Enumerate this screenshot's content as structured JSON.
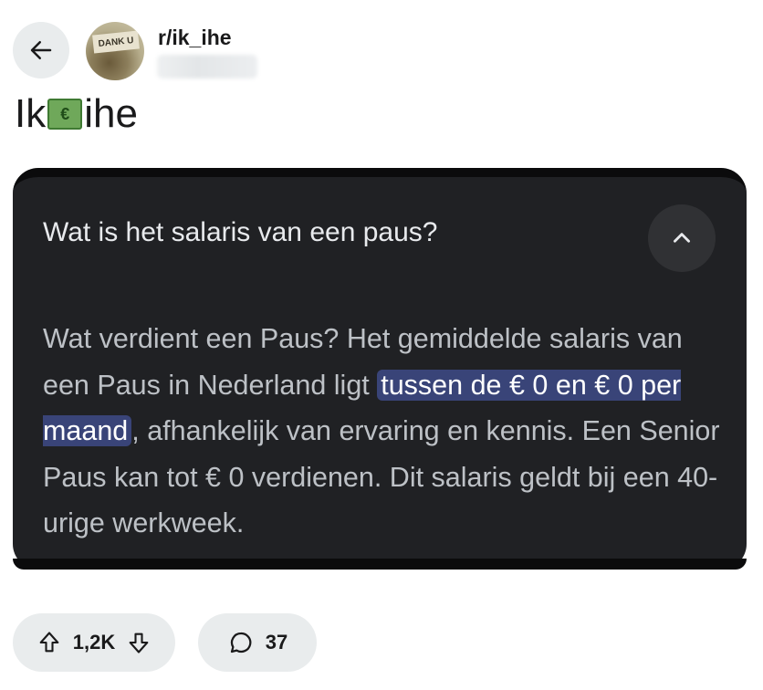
{
  "header": {
    "subreddit": "r/ik_ihe"
  },
  "post": {
    "title_prefix": "Ik",
    "title_suffix": "ihe",
    "title_icon_glyph": "€",
    "avatar_sign_text": "DANK U"
  },
  "card": {
    "question": "Wat is het salaris van een paus?",
    "answer_part1": "Wat verdient een Paus? Het gemiddelde salaris van een Paus in Nederland ligt ",
    "answer_highlight": "tussen de € 0 en € 0 per maand",
    "answer_part2": ", afhankelijk van ervaring en kennis. Een Senior Paus kan tot € 0 verdienen. Dit salaris geldt bij een 40-urige werkweek."
  },
  "actions": {
    "votes": "1,2K",
    "comments": "37"
  },
  "colors": {
    "card_bg": "#202124",
    "highlight_bg": "#394478",
    "pill_bg": "#e9eced"
  },
  "icons": [
    "back-arrow-icon",
    "money-icon",
    "chevron-up-icon",
    "upvote-icon",
    "downvote-icon",
    "comment-icon"
  ]
}
